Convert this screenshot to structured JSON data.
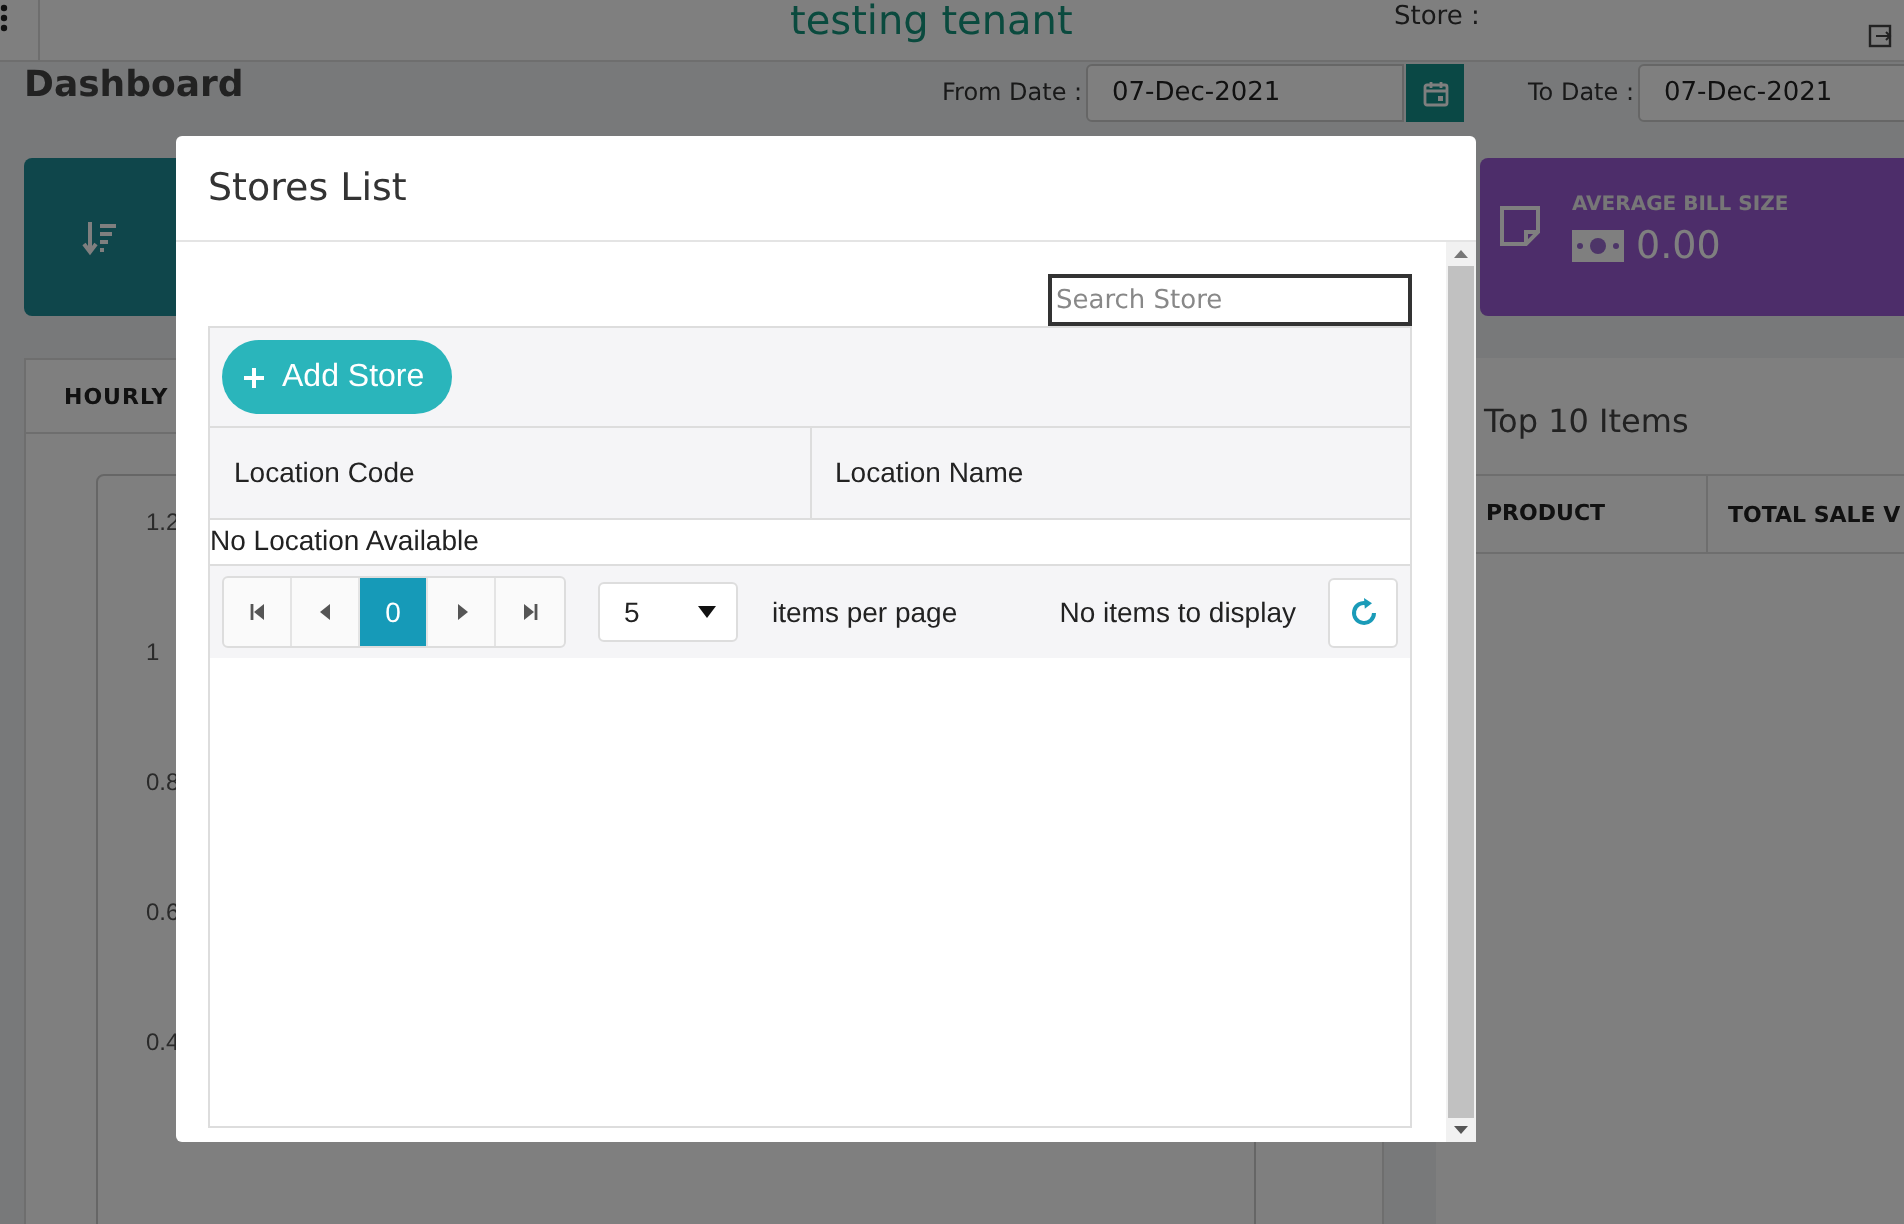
{
  "header": {
    "tenant": "testing tenant",
    "store_label": "Store :"
  },
  "page_title": "Dashboard",
  "filters": {
    "from_label": "From Date :",
    "from_value": "07-Dec-2021",
    "to_label": "To Date :",
    "to_value": "07-Dec-2021"
  },
  "summary_card": {
    "title": "AVERAGE BILL SIZE",
    "value": "0.00"
  },
  "hourly_panel": {
    "tab": "HOURLY",
    "y_ticks": [
      "1.2",
      "1",
      "0.8",
      "0.6",
      "0.4"
    ]
  },
  "top_items": {
    "title": "Top 10 Items",
    "columns": [
      "PRODUCT",
      "TOTAL SALE V"
    ]
  },
  "modal": {
    "title": "Stores List",
    "search": {
      "placeholder": "Search Store"
    },
    "add_button": "Add Store",
    "columns": [
      "Location Code",
      "Location Name"
    ],
    "empty_message": "No Location Available",
    "pager": {
      "pages": [
        {
          "label": "0",
          "selected": true
        }
      ],
      "page_size": "5",
      "page_size_label": "items per page",
      "status": "No items to display"
    }
  }
}
